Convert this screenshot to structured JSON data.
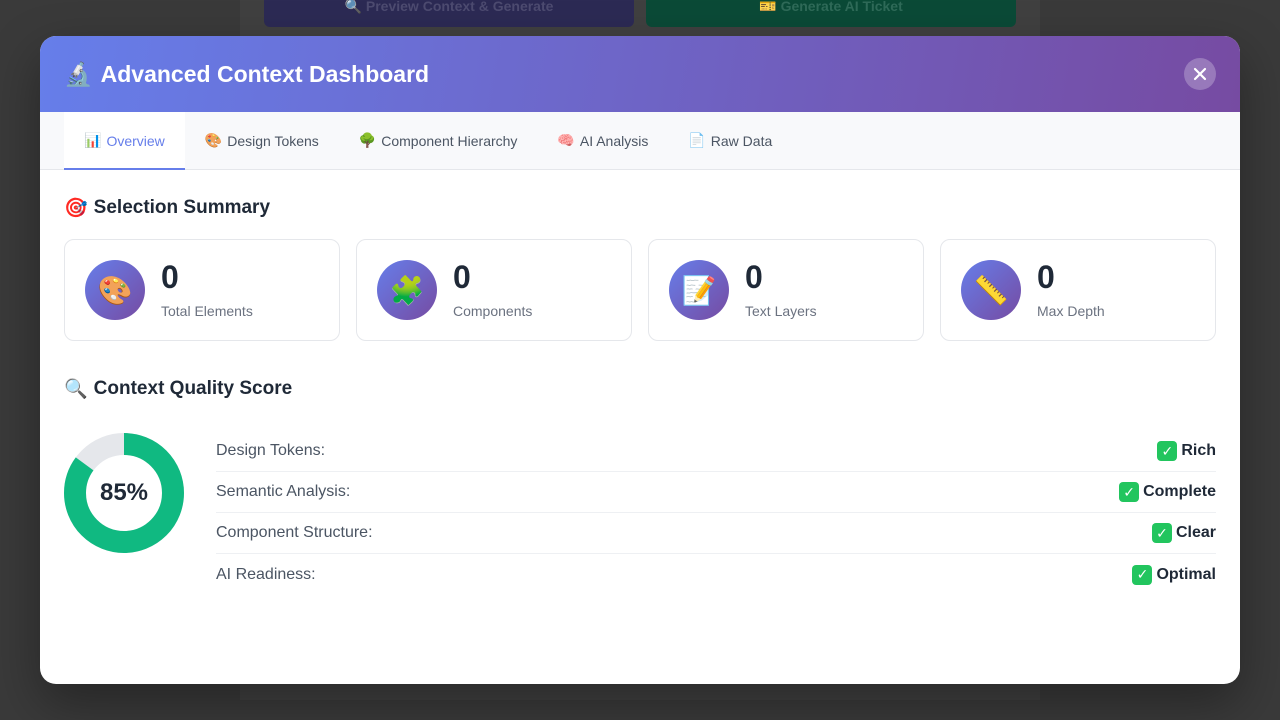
{
  "background": {
    "preview_label": "🔍 Preview Context & Generate",
    "generate_label": "🎫 Generate AI Ticket"
  },
  "modal": {
    "title_icon": "🔬",
    "title": "Advanced Context Dashboard",
    "close_label": "✕"
  },
  "tabs": [
    {
      "icon": "📊",
      "label": "Overview",
      "active": true
    },
    {
      "icon": "🎨",
      "label": "Design Tokens"
    },
    {
      "icon": "🌳",
      "label": "Component Hierarchy"
    },
    {
      "icon": "🧠",
      "label": "AI Analysis"
    },
    {
      "icon": "📄",
      "label": "Raw Data"
    }
  ],
  "summary": {
    "icon": "🎯",
    "title": "Selection Summary",
    "stats": [
      {
        "icon": "🎨",
        "value": "0",
        "label": "Total Elements"
      },
      {
        "icon": "🧩",
        "value": "0",
        "label": "Components"
      },
      {
        "icon": "📝",
        "value": "0",
        "label": "Text Layers"
      },
      {
        "icon": "📏",
        "value": "0",
        "label": "Max Depth"
      }
    ]
  },
  "quality": {
    "icon": "🔍",
    "title": "Context Quality Score",
    "score_label": "85%",
    "score_value": 0.85,
    "colors": {
      "fill": "#10b981",
      "track": "#e5e7eb"
    },
    "metrics": [
      {
        "label": "Design Tokens:",
        "check": "✓",
        "status": "Rich"
      },
      {
        "label": "Semantic Analysis:",
        "check": "✓",
        "status": "Complete"
      },
      {
        "label": "Component Structure:",
        "check": "✓",
        "status": "Clear"
      },
      {
        "label": "AI Readiness:",
        "check": "✓",
        "status": "Optimal"
      }
    ]
  }
}
